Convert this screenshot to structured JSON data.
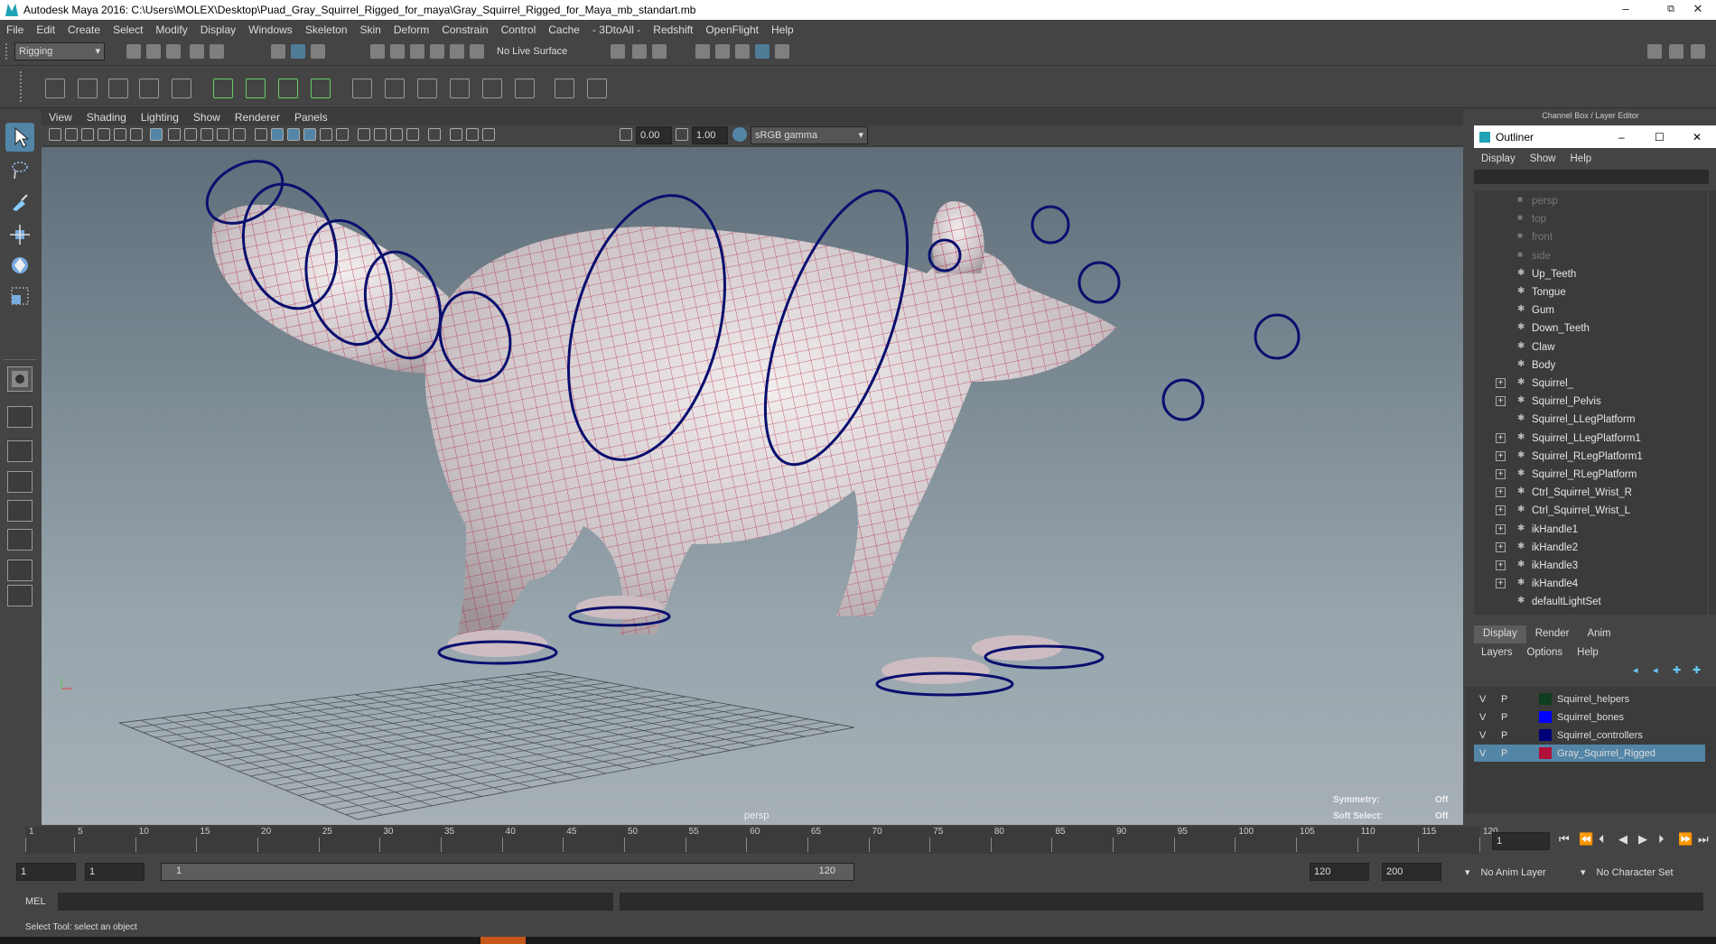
{
  "window": {
    "title": "Autodesk Maya 2016: C:\\Users\\MOLEX\\Desktop\\Puad_Gray_Squirrel_Rigged_for_maya\\Gray_Squirrel_Rigged_for_Maya_mb_standart.mb",
    "minimize": "–",
    "maximize": "⧉",
    "close": "✕"
  },
  "menubar": [
    "File",
    "Edit",
    "Create",
    "Select",
    "Modify",
    "Display",
    "Windows",
    "Skeleton",
    "Skin",
    "Deform",
    "Constrain",
    "Control",
    "Cache",
    "- 3DtoAll -",
    "Redshift",
    "OpenFlight",
    "Help"
  ],
  "statusline": {
    "menuset": "Rigging",
    "live_surface": "No Live Surface"
  },
  "viewport": {
    "menu": [
      "View",
      "Shading",
      "Lighting",
      "Show",
      "Renderer",
      "Panels"
    ],
    "exposure": "0.00",
    "gamma": "1.00",
    "color_space": "sRGB gamma",
    "camera_label": "persp",
    "hud": {
      "symmetry_label": "Symmetry:",
      "symmetry_value": "Off",
      "soft_select_label": "Soft Select:",
      "soft_select_value": "Off"
    }
  },
  "channel_box": {
    "title": "Channel Box / Layer Editor"
  },
  "outliner": {
    "title": "Outliner",
    "menu": [
      "Display",
      "Show",
      "Help"
    ],
    "items": [
      {
        "label": "persp",
        "dim": true,
        "expand": false
      },
      {
        "label": "top",
        "dim": true,
        "expand": false
      },
      {
        "label": "front",
        "dim": true,
        "expand": false
      },
      {
        "label": "side",
        "dim": true,
        "expand": false
      },
      {
        "label": "Up_Teeth",
        "dim": false,
        "expand": false
      },
      {
        "label": "Tongue",
        "dim": false,
        "expand": false
      },
      {
        "label": "Gum",
        "dim": false,
        "expand": false
      },
      {
        "label": "Down_Teeth",
        "dim": false,
        "expand": false
      },
      {
        "label": "Claw",
        "dim": false,
        "expand": false
      },
      {
        "label": "Body",
        "dim": false,
        "expand": false
      },
      {
        "label": "Squirrel_",
        "dim": false,
        "expand": true
      },
      {
        "label": "Squirrel_Pelvis",
        "dim": false,
        "expand": true
      },
      {
        "label": "Squirrel_LLegPlatform",
        "dim": false,
        "expand": false
      },
      {
        "label": "Squirrel_LLegPlatform1",
        "dim": false,
        "expand": true
      },
      {
        "label": "Squirrel_RLegPlatform1",
        "dim": false,
        "expand": true
      },
      {
        "label": "Squirrel_RLegPlatform",
        "dim": false,
        "expand": true
      },
      {
        "label": "Ctrl_Squirrel_Wrist_R",
        "dim": false,
        "expand": true
      },
      {
        "label": "Ctrl_Squirrel_Wrist_L",
        "dim": false,
        "expand": true
      },
      {
        "label": "ikHandle1",
        "dim": false,
        "expand": true
      },
      {
        "label": "ikHandle2",
        "dim": false,
        "expand": true
      },
      {
        "label": "ikHandle3",
        "dim": false,
        "expand": true
      },
      {
        "label": "ikHandle4",
        "dim": false,
        "expand": true
      },
      {
        "label": "defaultLightSet",
        "dim": false,
        "expand": false
      }
    ]
  },
  "layer_editor": {
    "tabs": [
      "Display",
      "Render",
      "Anim"
    ],
    "menu": [
      "Layers",
      "Options",
      "Help"
    ],
    "layers": [
      {
        "v": "V",
        "p": "P",
        "color": "#0f3d1f",
        "name": "Squirrel_helpers",
        "selected": false
      },
      {
        "v": "V",
        "p": "P",
        "color": "#0000ff",
        "name": "Squirrel_bones",
        "selected": false
      },
      {
        "v": "V",
        "p": "P",
        "color": "#00007a",
        "name": "Squirrel_controllers",
        "selected": false
      },
      {
        "v": "V",
        "p": "P",
        "color": "#b0103a",
        "name": "Gray_Squirrel_Rigged",
        "selected": true
      }
    ]
  },
  "timeline": {
    "ticks": [
      "1",
      "5",
      "10",
      "15",
      "20",
      "25",
      "30",
      "35",
      "40",
      "45",
      "50",
      "55",
      "60",
      "65",
      "70",
      "75",
      "80",
      "85",
      "90",
      "95",
      "100",
      "105",
      "110",
      "115",
      "120"
    ],
    "current_frame": "1"
  },
  "range": {
    "start": "1",
    "playback_start": "1",
    "slider_start": "1",
    "slider_end": "120",
    "playback_end": "120",
    "end": "200",
    "anim_layer": "No Anim Layer",
    "character_set": "No Character Set"
  },
  "cmdline": {
    "label": "MEL"
  },
  "helpline": {
    "text": "Select Tool: select an object"
  },
  "colors": {
    "ui_bg": "#444444",
    "accent": "#5285a6",
    "wire": "#b0103a",
    "controller": "#0a0f6e"
  }
}
